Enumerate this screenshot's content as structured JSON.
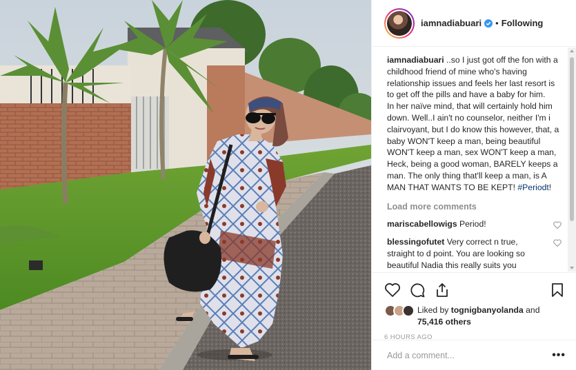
{
  "post": {
    "username": "iamnadiabuari",
    "follow_status": "Following",
    "separator": "•",
    "verified": true
  },
  "caption": {
    "username": "iamnadiabuari",
    "text_1": "..so I just got off the fon with a childhood friend of mine who's having relationship issues and feels her last resort is to get off the pills and have a baby for him.",
    "text_2": "In her naïve mind, that will certainly hold him down. Well..I ain't no counselor, neither I'm i clairvoyant, but I do know this however, that, a baby WON'T keep a man, being beautiful WON'T keep a man, sex WON'T keep a man, Heck, being a good woman, BARELY keeps a man. The only thing that'll keep a man, is A MAN THAT WANTS TO BE KEPT!",
    "hashtag": "#Periodt",
    "suffix": "!"
  },
  "load_more": "Load more comments",
  "comments": [
    {
      "username": "mariscabellowigs",
      "text": "Period!"
    },
    {
      "username": "blessingofutet",
      "text": "Very correct n true, straight to d point. You are looking so beautiful Nadia this really suits you"
    }
  ],
  "likes": {
    "prefix": "Liked by",
    "user": "tognigbanyolanda",
    "conjunction": "and",
    "count": "75,416 others"
  },
  "timestamp": "6 hours ago",
  "add_comment_placeholder": "Add a comment...",
  "more_options": "•••",
  "icons": {
    "like": "heart-icon",
    "comment": "comment-icon",
    "share": "share-icon",
    "save": "bookmark-icon",
    "verified": "verified-badge-icon"
  },
  "colors": {
    "text": "#262626",
    "muted": "#8e8e8e",
    "hashtag": "#003569",
    "verified": "#3897f0",
    "border": "#efefef"
  }
}
